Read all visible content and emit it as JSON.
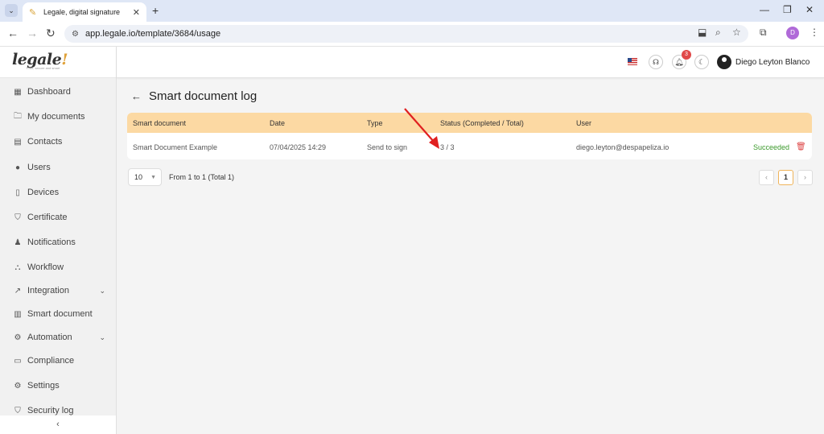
{
  "browser": {
    "tab_title": "Legale, digital signature",
    "url": "app.legale.io/template/3684/usage",
    "profile_initial": "D"
  },
  "app": {
    "logo_text": "legale",
    "logo_tagline": "Free, secure and smart",
    "sidebar": [
      {
        "label": "Dashboard",
        "icon": "dashboard-icon"
      },
      {
        "label": "My documents",
        "icon": "folder-icon"
      },
      {
        "label": "Contacts",
        "icon": "contacts-icon"
      },
      {
        "label": "Users",
        "icon": "user-icon"
      },
      {
        "label": "Devices",
        "icon": "tablet-icon"
      },
      {
        "label": "Certificate",
        "icon": "shield-icon"
      },
      {
        "label": "Notifications",
        "icon": "bell-icon"
      },
      {
        "label": "Workflow",
        "icon": "workflow-icon"
      },
      {
        "label": "Integration",
        "icon": "integration-icon"
      },
      {
        "label": "Smart document",
        "icon": "smart-document-icon"
      },
      {
        "label": "Automation",
        "icon": "gear-icon"
      },
      {
        "label": "Compliance",
        "icon": "chat-icon"
      },
      {
        "label": "Settings",
        "icon": "settings-icon"
      },
      {
        "label": "Security log",
        "icon": "security-shield-icon"
      }
    ],
    "topbar": {
      "notification_count": "3",
      "user_name": "Diego Leyton Blanco"
    },
    "page_title": "Smart document log",
    "table": {
      "headers": [
        "Smart document",
        "Date",
        "Type",
        "Status (Completed / Total)",
        "User"
      ],
      "rows": [
        {
          "name": "Smart Document Example",
          "date": "07/04/2025 14:29",
          "type": "Send to sign",
          "status": "3 / 3",
          "user": "diego.leyton@despapeliza.io",
          "result": "Succeeded"
        }
      ]
    },
    "pagination": {
      "page_size": "10",
      "info": "From 1 to 1 (Total 1)",
      "current_page": "1"
    }
  },
  "colors": {
    "table_header": "#fcd9a3",
    "success": "#3c9a2c",
    "annotation_arrow": "#e02020"
  }
}
